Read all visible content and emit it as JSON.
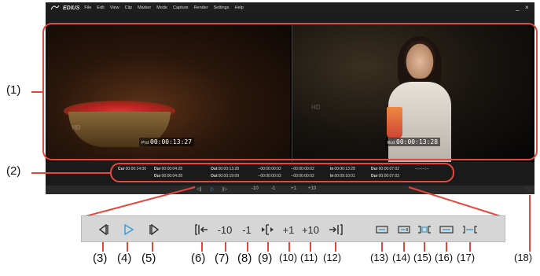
{
  "app": {
    "logo_text": "EDIUS",
    "menu": [
      "File",
      "Edit",
      "View",
      "Clip",
      "Marker",
      "Mode",
      "Capture",
      "Render",
      "Settings",
      "Help"
    ],
    "minimize": "_",
    "close": "×"
  },
  "player": {
    "tag": "Pld",
    "timecode": "00:00:13:27"
  },
  "recorder": {
    "tag": "Rcd",
    "timecode": "00:00:13:28"
  },
  "watermark": "HD",
  "info": {
    "cur_label": "Cur",
    "cur": "00:00:14:00",
    "dur1_label": "Dur",
    "dur1": "00:00:04:28",
    "dur1b": "00:00:04:28",
    "out1_label": "Out",
    "out1": "00:00:13:28",
    "out1b": "00:00:19:09",
    "dur2_label": "Dur",
    "dur2": "00:10:19:09",
    "delta1": "--00:00:00:02",
    "delta1b": "--00:00:00:02",
    "delta2": "--00:00:00:02",
    "delta2b": "--00:00:00:02",
    "in_label": "In",
    "in1": "00:00:13:28",
    "in2": "00:09:10:01",
    "dur3_label": "Dur",
    "dur3": "00:00:07:02",
    "dur3b": "00:00:07:02",
    "blank": "--:--:--:--"
  },
  "controls": {
    "step_back": "◁|",
    "play": "▷",
    "step_fwd": "|▷",
    "minus10": "-10",
    "minus1": "-1",
    "plus1": "+1",
    "plus10": "+10"
  },
  "callouts": [
    "(1)",
    "(2)",
    "(3)",
    "(4)",
    "(5)",
    "(6)",
    "(7)",
    "(8)",
    "(9)",
    "(10)",
    "(11)",
    "(12)",
    "(13)",
    "(14)",
    "(15)",
    "(16)",
    "(17)",
    "(18)"
  ],
  "colors": {
    "callout": "#e8463c",
    "play": "#3aa0d8"
  }
}
